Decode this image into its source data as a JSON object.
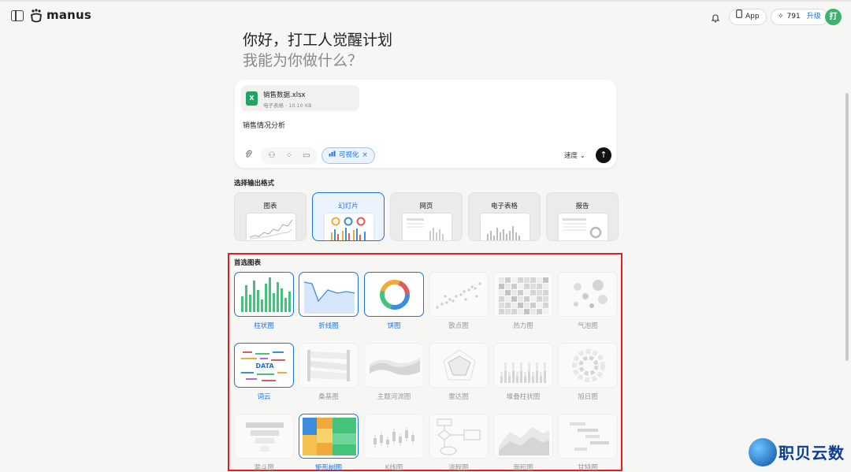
{
  "header": {
    "logo_text": "manus",
    "app_label": "App",
    "credits": "791",
    "upgrade_label": "升级",
    "avatar_initial": "打"
  },
  "greeting": {
    "line1": "你好，打工人觉醒计划",
    "line2": "我能为你做什么？"
  },
  "composer": {
    "file": {
      "name": "销售数据.xlsx",
      "meta": "电子表格 · 10.10 KB",
      "icon_letter": "X"
    },
    "prompt": "销售情况分析",
    "viz_chip_label": "可视化",
    "speed_label": "速度",
    "send_icon": "arrow-up-icon"
  },
  "output_format": {
    "label": "选择输出格式",
    "options": [
      {
        "label": "图表",
        "selected": false
      },
      {
        "label": "幻灯片",
        "selected": true
      },
      {
        "label": "网页",
        "selected": false
      },
      {
        "label": "电子表格",
        "selected": false
      },
      {
        "label": "报告",
        "selected": false
      }
    ]
  },
  "preferred_charts": {
    "label": "首选图表",
    "items": [
      {
        "label": "柱状图",
        "active": true
      },
      {
        "label": "折线图",
        "active": true
      },
      {
        "label": "饼图",
        "active": true
      },
      {
        "label": "散点图",
        "active": false
      },
      {
        "label": "热力图",
        "active": false
      },
      {
        "label": "气泡图",
        "active": false
      },
      {
        "label": "词云",
        "active": true
      },
      {
        "label": "桑基图",
        "active": false
      },
      {
        "label": "主题河流图",
        "active": false
      },
      {
        "label": "雷达图",
        "active": false
      },
      {
        "label": "堆叠柱状图",
        "active": false
      },
      {
        "label": "旭日图",
        "active": false
      },
      {
        "label": "漏斗图",
        "active": false
      },
      {
        "label": "矩形树图",
        "active": true
      },
      {
        "label": "K线图",
        "active": false
      },
      {
        "label": "流程图",
        "active": false
      },
      {
        "label": "面积图",
        "active": false
      },
      {
        "label": "甘特图",
        "active": false
      }
    ]
  },
  "wordcloud_word": "DATA",
  "watermark": "职贝云数",
  "colors": {
    "accent": "#1a73e8",
    "avatar": "#3cb371",
    "excel": "#21a366",
    "highlight_border": "#e02020"
  }
}
